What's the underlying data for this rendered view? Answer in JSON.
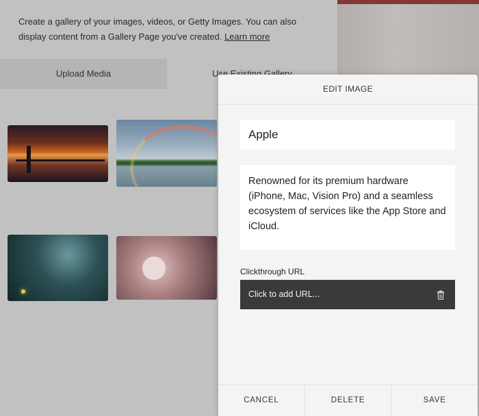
{
  "left_panel": {
    "intro_text": "Create a gallery of your images, videos, or Getty Images. You can also display content from a Gallery Page you've created.",
    "learn_more": "Learn more",
    "tabs": [
      {
        "label": "Upload Media"
      },
      {
        "label": "Use Existing Gallery"
      }
    ]
  },
  "modal": {
    "title": "EDIT IMAGE",
    "image_title": "Apple",
    "description": "Renowned for its premium hardware (iPhone, Mac, Vision Pro) and a seamless ecosystem of services like the App Store and iCloud.",
    "clickthrough_label": "Clickthrough URL",
    "clickthrough_placeholder": "Click to add URL...",
    "buttons": {
      "cancel": "CANCEL",
      "delete": "DELETE",
      "save": "SAVE"
    }
  },
  "colors": {
    "modal_bg": "#f4f4f4",
    "url_bar_bg": "#3a3a3a",
    "panel_bg": "#c9c9c9"
  },
  "icons": {
    "trash": "trash-icon"
  }
}
